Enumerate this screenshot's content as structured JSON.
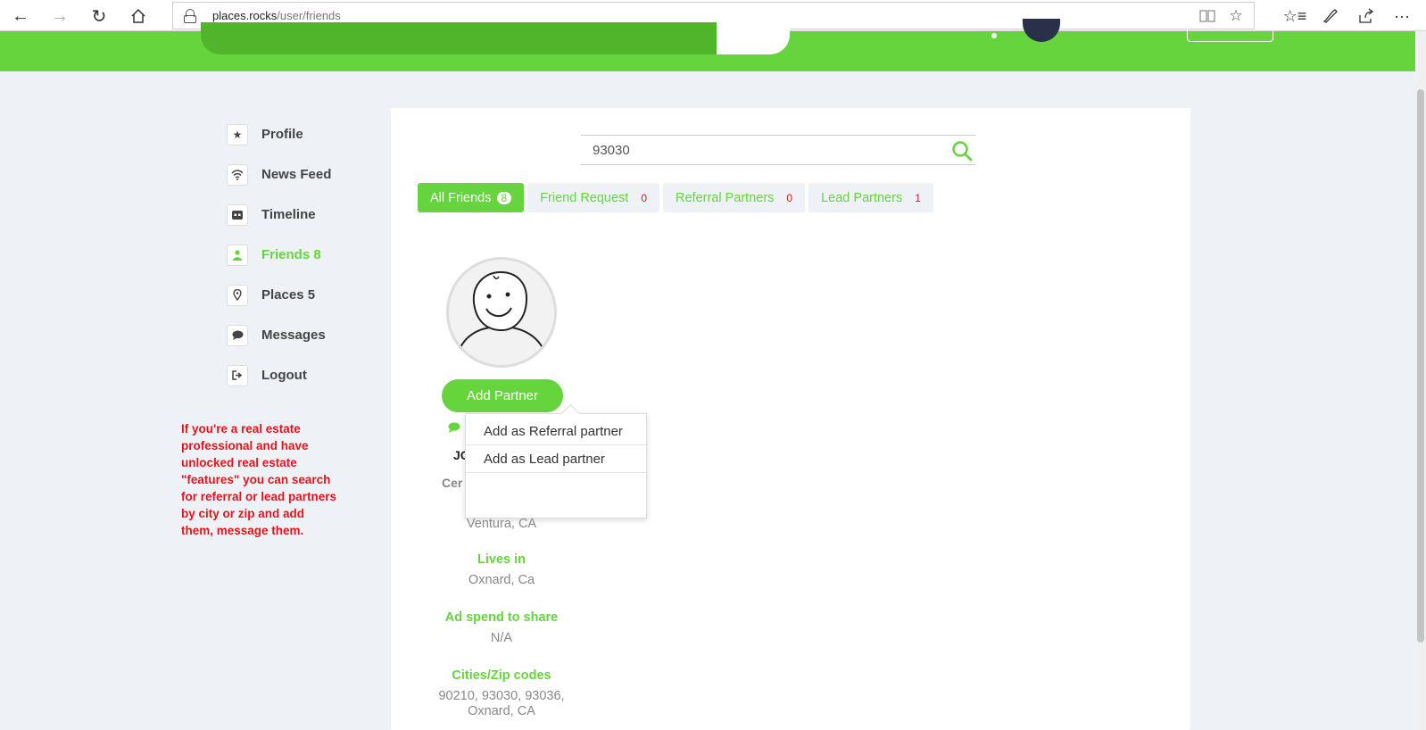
{
  "browser": {
    "url_host": "places.rocks",
    "url_path": "/user/friends"
  },
  "sidebar": {
    "items": [
      {
        "label": "Profile",
        "icon": "star-icon"
      },
      {
        "label": "News Feed",
        "icon": "wifi-icon"
      },
      {
        "label": "Timeline",
        "icon": "timeline-icon"
      },
      {
        "label": "Friends 8",
        "icon": "user-icon",
        "active": true
      },
      {
        "label": "Places 5",
        "icon": "map-pin-icon"
      },
      {
        "label": "Messages",
        "icon": "chat-icon"
      },
      {
        "label": "Logout",
        "icon": "logout-icon"
      }
    ]
  },
  "annotation": "If you're a real estate professional and have unlocked real estate \"features\" you can search for referral or lead partners by city or zip and add them, message them.",
  "search": {
    "value": "93030"
  },
  "tabs": [
    {
      "label": "All Friends",
      "count": "8",
      "active": true
    },
    {
      "label": "Friend Request",
      "count": "0"
    },
    {
      "label": "Referral Partners",
      "count": "0"
    },
    {
      "label": "Lead Partners",
      "count": "1"
    }
  ],
  "friend": {
    "add_partner_label": "Add Partner",
    "dropdown": [
      "Add as Referral partner",
      "Add as Lead partner"
    ],
    "name_fragment": "JO",
    "cert_fragment": "Cer",
    "location": "Ventura, CA",
    "lives_in_label": "Lives in",
    "lives_in_value": "Oxnard, Ca",
    "ad_spend_label": "Ad spend to share",
    "ad_spend_value": "N/A",
    "cities_label": "Cities/Zip codes",
    "cities_value_line1": "90210, 93030, 93036,",
    "cities_value_line2": "Oxnard, CA"
  },
  "colors": {
    "brand_green": "#66d43c",
    "annotation_red": "#e8131a"
  }
}
